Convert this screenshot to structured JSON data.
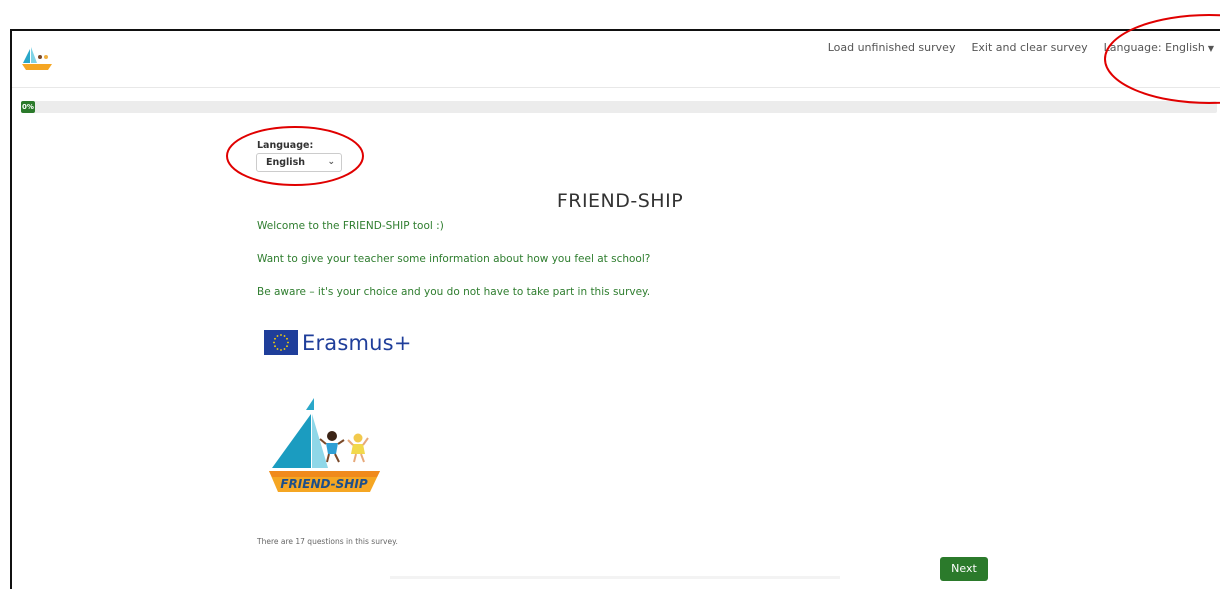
{
  "nav": {
    "load_unfinished": "Load unfinished survey",
    "exit_clear": "Exit and clear survey",
    "language": "Language: English"
  },
  "progress": {
    "label": "0%",
    "value": 0
  },
  "language_select": {
    "label": "Language:",
    "selected": "English"
  },
  "survey": {
    "title": "FRIEND-SHIP",
    "welcome_lines": [
      "Welcome to the FRIEND-SHIP tool :)",
      "Want to give your teacher some information about how you feel at school?",
      "Be aware – it's your choice and you do not have to take part in this survey."
    ],
    "question_count_text": "There are 17 questions in this survey."
  },
  "erasmus": {
    "text": "Erasmus+"
  },
  "logo": {
    "text": "FRIEND-SHIP"
  },
  "buttons": {
    "next": "Next"
  },
  "colors": {
    "accent_green": "#2b7a2b",
    "text_green": "#2e7d2e",
    "annotation_red": "#e00000",
    "eu_blue": "#1f3e9a"
  }
}
